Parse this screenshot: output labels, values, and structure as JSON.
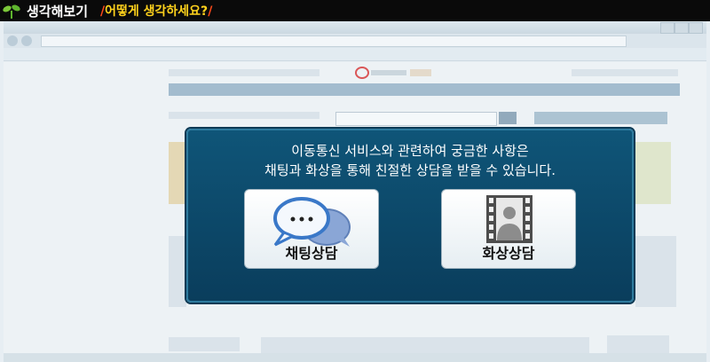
{
  "header": {
    "title": "생각해보기",
    "question": "어떻게 생각하세요?"
  },
  "modal": {
    "line1": "이동통신 서비스와 관련하여 궁금한 사항은",
    "line2": "채팅과 화상을 통해 친절한 상담을 받을 수 있습니다.",
    "chat_label": "채팅상담",
    "video_label": "화상상담"
  },
  "colors": {
    "modal_bg": "#0f5578",
    "header_bg": "#0a0a0a",
    "question_color": "#ffd21c",
    "accent": "#ff4a1a"
  }
}
